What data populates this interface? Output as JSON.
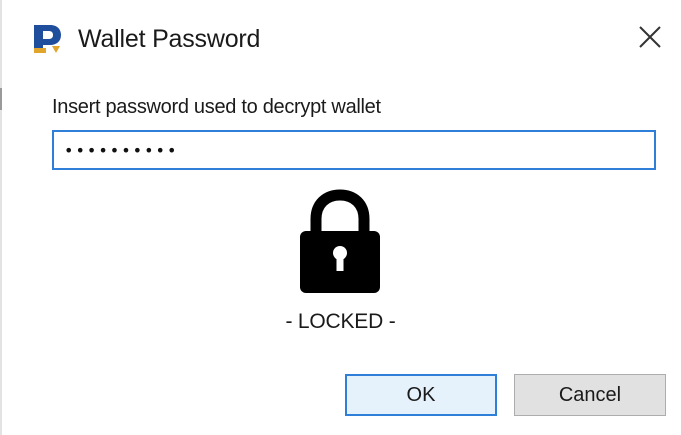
{
  "window": {
    "title": "Wallet Password",
    "app_icon": "app-p-logo-icon",
    "close_icon": "close-icon"
  },
  "form": {
    "prompt": "Insert password used to decrypt wallet",
    "password_value": "••••••••••"
  },
  "lock": {
    "icon": "padlock-icon",
    "status": "- LOCKED -"
  },
  "buttons": {
    "ok_label": "OK",
    "cancel_label": "Cancel"
  },
  "colors": {
    "accent": "#2f7ed8",
    "ok_bg": "#e5f1fb",
    "cancel_bg": "#e1e1e1",
    "logo_blue": "#1f4e9c",
    "logo_gold": "#e0a52a"
  }
}
